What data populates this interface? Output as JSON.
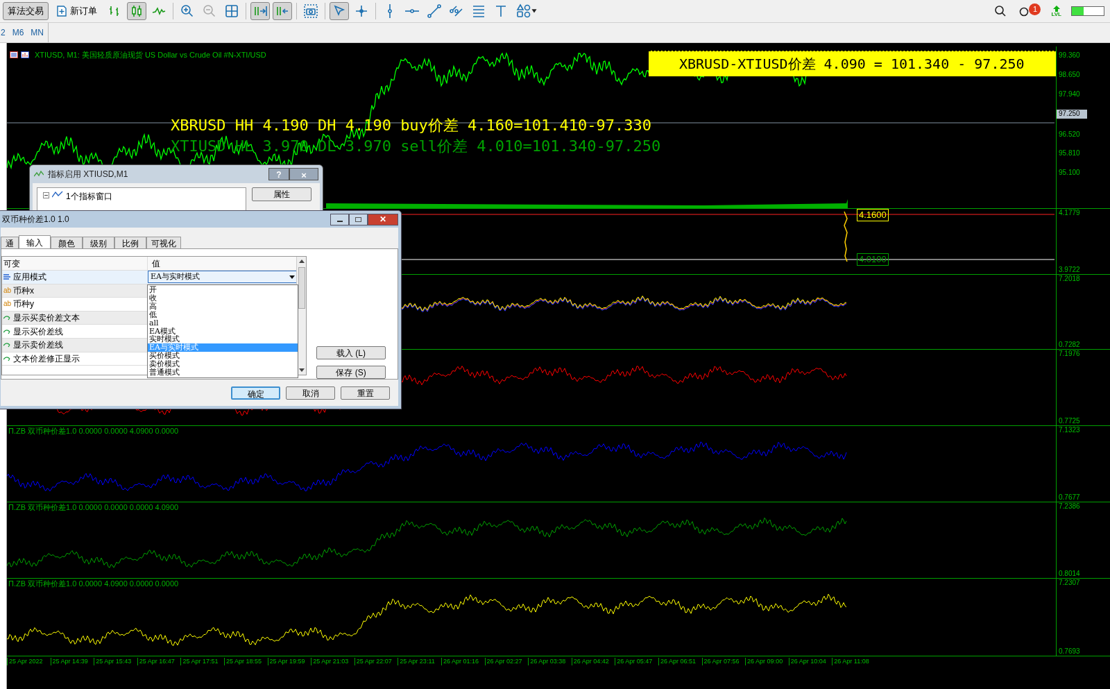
{
  "toolbar": {
    "text_buttons": [
      {
        "kind": "algo",
        "label": "算法交易",
        "pressed": true
      },
      {
        "kind": "order",
        "label": "新订单",
        "pressed": false
      }
    ],
    "tools": [
      {
        "kind": "bars",
        "pressed": false
      },
      {
        "kind": "candles",
        "pressed": true
      },
      {
        "kind": "line",
        "pressed": false
      },
      {
        "kind": "sep"
      },
      {
        "kind": "zoomin",
        "pressed": false
      },
      {
        "kind": "zoomout",
        "pressed": false
      },
      {
        "kind": "tile",
        "pressed": false
      },
      {
        "kind": "sep"
      },
      {
        "kind": "autoscroll",
        "pressed": true
      },
      {
        "kind": "shift",
        "pressed": true
      },
      {
        "kind": "sep"
      },
      {
        "kind": "screenshot",
        "pressed": false
      },
      {
        "kind": "sep"
      },
      {
        "kind": "cursor",
        "pressed": true
      },
      {
        "kind": "crosshair",
        "pressed": false
      },
      {
        "kind": "sep"
      },
      {
        "kind": "vline",
        "pressed": false
      },
      {
        "kind": "hline",
        "pressed": false
      },
      {
        "kind": "trend",
        "pressed": false
      },
      {
        "kind": "channel",
        "pressed": false
      },
      {
        "kind": "fibo",
        "pressed": false
      },
      {
        "kind": "text",
        "pressed": false
      },
      {
        "kind": "shapes",
        "pressed": false
      }
    ],
    "notification_count": "1",
    "level_label": "LVL",
    "level": 0.38
  },
  "timeframes": [
    "2",
    "M6",
    "MN"
  ],
  "chart": {
    "header": "XTIUSD, M1:  美国轻质原油现货 US Dollar vs Crude Oil #N-XTI/USD",
    "spread_box": "XBRUSD-XTIUSD价差  4.090 = 101.340 - 97.250",
    "buy_line": "XBRUSD HH 4.190 DH 4.190 buy价差    4.160=101.410-97.330",
    "sell_line": "XTIUSD HL 3.970 DL 3.970 sell价差  4.010=101.340-97.250",
    "price_tag": "97.250",
    "main_ticks": [
      "99.360",
      "98.650",
      "97.940",
      "96.520",
      "95.810",
      "95.100"
    ],
    "buy_label": "4.1600",
    "sell_label": "4.0100",
    "panes": [
      {
        "kind": "spread",
        "ticks": [
          "4.1779",
          "3.9722"
        ]
      },
      {
        "kind": "multi",
        "ticks": [
          "7.2018",
          "0.7282"
        ]
      },
      {
        "kind": "line",
        "color": "#ff0000",
        "ticks": [
          "7.1976",
          "0.7725"
        ]
      },
      {
        "kind": "line",
        "color": "#0000ff",
        "label": "Π.ZB 双币种价差1.0 0.0000 0.0000 4.0900 0.0000",
        "ticks": [
          "7.1323",
          "0.7677"
        ]
      },
      {
        "kind": "line",
        "color": "#00a000",
        "label": "Π.ZB 双币种价差1.0 0.0000 0.0000 0.0000 4.0900",
        "ticks": [
          "7.2386",
          "0.8014"
        ]
      },
      {
        "kind": "line",
        "color": "#ffff00",
        "label": "Π.ZB 双币种价差1.0 0.0000 4.0900 0.0000 0.0000",
        "ticks": [
          "7.2307",
          "0.7693"
        ]
      }
    ],
    "time_labels": [
      "25 Apr 2022",
      "25 Apr 14:39",
      "25 Apr 15:43",
      "25 Apr 16:47",
      "25 Apr 17:51",
      "25 Apr 18:55",
      "25 Apr 19:59",
      "25 Apr 21:03",
      "25 Apr 22:07",
      "25 Apr 23:11",
      "26 Apr 01:16",
      "26 Apr 02:27",
      "26 Apr 03:38",
      "26 Apr 04:42",
      "26 Apr 05:47",
      "26 Apr 06:51",
      "26 Apr 07:56",
      "26 Apr 09:00",
      "26 Apr 10:04",
      "26 Apr 11:08"
    ]
  },
  "back_dialog": {
    "title": "指标启用 XTIUSD,M1",
    "help": "?",
    "close": "×",
    "tree_item": "1个指标窗口",
    "button": "属性"
  },
  "dialog": {
    "title": "双币种价差1.0 1.0",
    "close": "✕",
    "tabs": [
      {
        "label": "通",
        "selected": false
      },
      {
        "label": "输入",
        "selected": true
      },
      {
        "label": "颜色",
        "selected": false
      },
      {
        "label": "级别",
        "selected": false
      },
      {
        "label": "比例",
        "selected": false
      },
      {
        "label": "可视化",
        "selected": false
      }
    ],
    "columns": [
      "可变",
      "值"
    ],
    "rows": [
      {
        "kind": "enum",
        "name": "应用模式",
        "value": "EA与实时模式"
      },
      {
        "kind": "string",
        "icon": "ab",
        "name": "币种x"
      },
      {
        "kind": "string",
        "icon": "ab",
        "name": "币种y"
      },
      {
        "kind": "bool",
        "name": "显示买卖价差文本"
      },
      {
        "kind": "bool",
        "name": "显示买价差线"
      },
      {
        "kind": "bool",
        "name": "显示卖价差线"
      },
      {
        "kind": "bool",
        "name": "文本价差修正显示"
      }
    ],
    "options": [
      {
        "label": "开",
        "selected": false
      },
      {
        "label": "收",
        "selected": false
      },
      {
        "label": "高",
        "selected": false
      },
      {
        "label": "低",
        "selected": false
      },
      {
        "label": "all",
        "selected": false
      },
      {
        "label": "EA模式",
        "selected": false
      },
      {
        "label": "实时模式",
        "selected": false
      },
      {
        "label": "EA与实时模式",
        "selected": true
      },
      {
        "label": "买价模式",
        "selected": false
      },
      {
        "label": "卖价模式",
        "selected": false
      },
      {
        "label": "普通模式",
        "selected": false
      }
    ],
    "side_buttons": [
      "载入 (L)",
      "保存 (S)"
    ],
    "buttons": [
      {
        "label": "确定",
        "default": true
      },
      {
        "label": "取消",
        "default": false
      },
      {
        "label": "重置",
        "default": false
      }
    ]
  }
}
